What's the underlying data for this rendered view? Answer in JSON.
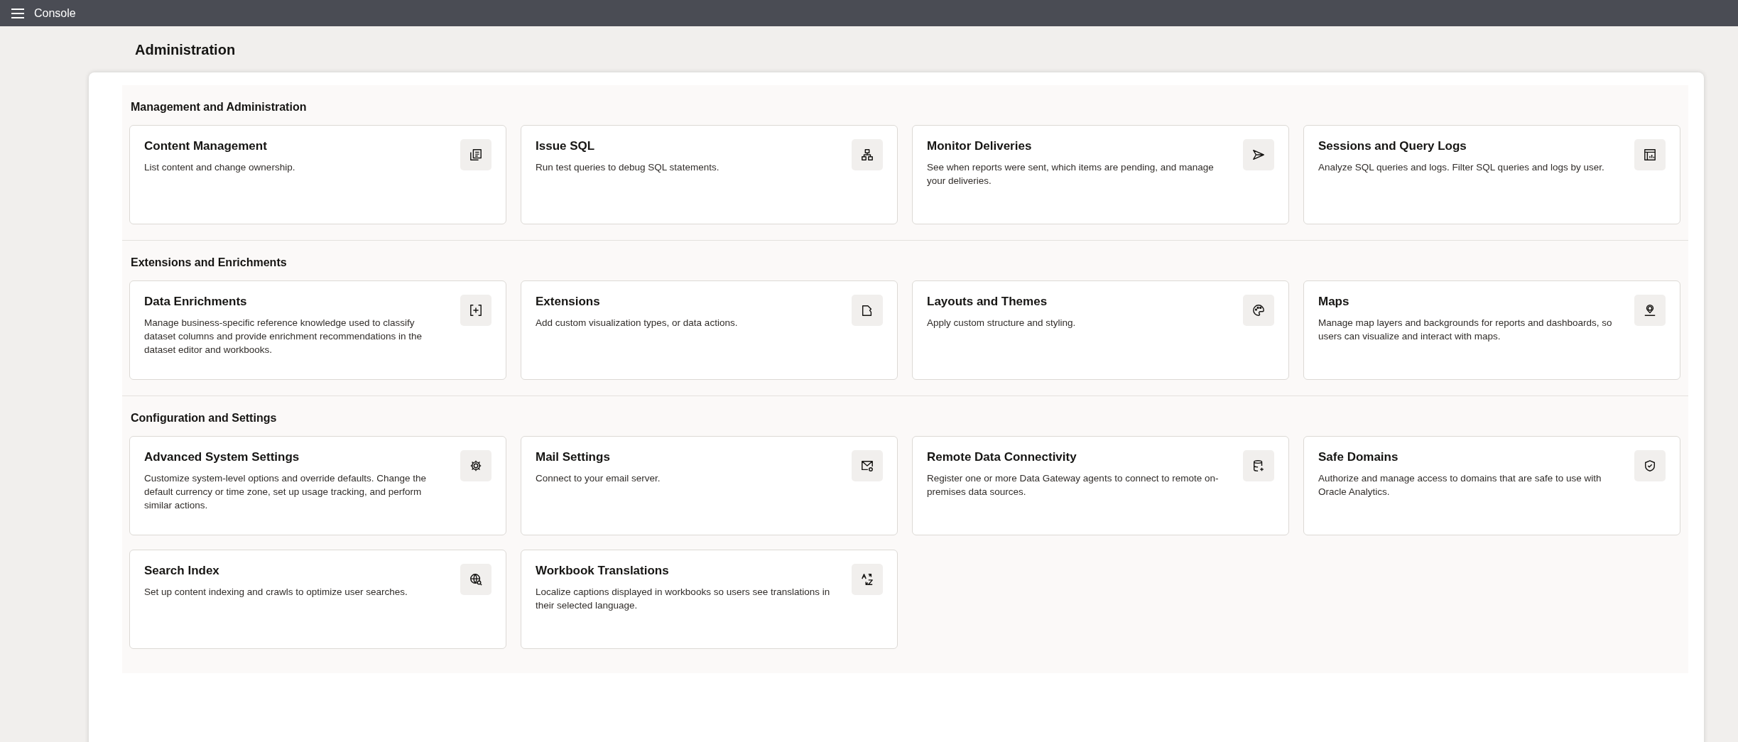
{
  "top_bar": {
    "title": "Console"
  },
  "page_title": "Administration",
  "sections": [
    {
      "title": "Management and Administration",
      "cards": [
        {
          "title": "Content Management",
          "description": "List content and change ownership."
        },
        {
          "title": "Issue SQL",
          "description": "Run test queries to debug SQL statements."
        },
        {
          "title": "Monitor Deliveries",
          "description": "See when reports were sent, which items are pending, and manage your deliveries."
        },
        {
          "title": "Sessions and Query Logs",
          "description": "Analyze SQL queries and logs. Filter SQL queries and logs by user."
        }
      ]
    },
    {
      "title": "Extensions and Enrichments",
      "cards": [
        {
          "title": "Data Enrichments",
          "description": "Manage business-specific reference knowledge used to classify dataset columns and provide enrichment recommendations in the dataset editor and workbooks."
        },
        {
          "title": "Extensions",
          "description": "Add custom visualization types, or data actions."
        },
        {
          "title": "Layouts and Themes",
          "description": "Apply custom structure and styling."
        },
        {
          "title": "Maps",
          "description": "Manage map layers and backgrounds for reports and dashboards, so users can visualize and interact with maps."
        }
      ]
    },
    {
      "title": "Configuration and Settings",
      "cards": [
        {
          "title": "Advanced System Settings",
          "description": "Customize system-level options and override defaults. Change the default currency or time zone, set up usage tracking, and perform similar actions."
        },
        {
          "title": "Mail Settings",
          "description": "Connect to your email server."
        },
        {
          "title": "Remote Data Connectivity",
          "description": "Register one or more Data Gateway agents to connect to remote on-premises data sources."
        },
        {
          "title": "Safe Domains",
          "description": "Authorize and manage access to domains that are safe to use with Oracle Analytics."
        },
        {
          "title": "Search Index",
          "description": "Set up content indexing and crawls to optimize user searches."
        },
        {
          "title": "Workbook Translations",
          "description": "Localize captions displayed in workbooks so users see translations in their selected language."
        }
      ]
    }
  ]
}
